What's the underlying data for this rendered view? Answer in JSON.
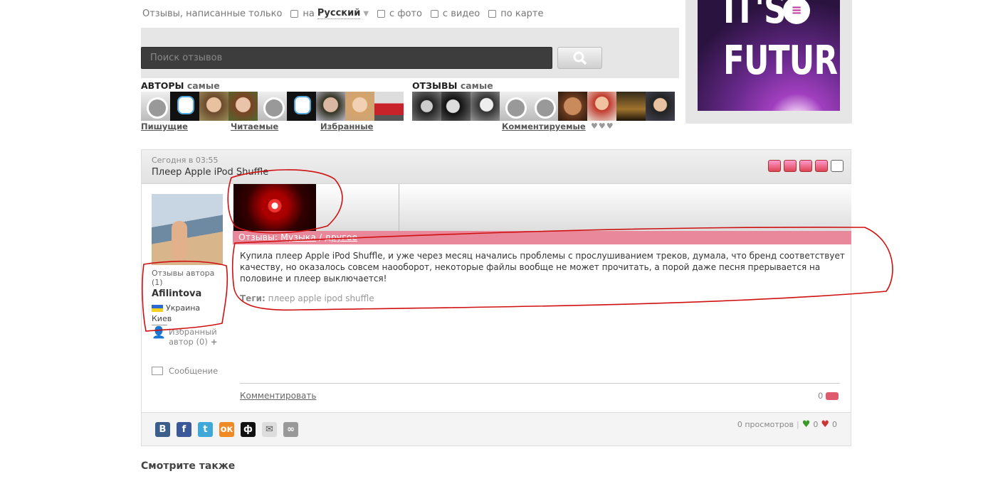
{
  "filters": {
    "intro": "Отзывы, написанные только",
    "lang_prefix": "на",
    "lang_value": "Русский",
    "with_photo": "с фото",
    "with_video": "с видео",
    "on_map": "по карте"
  },
  "search": {
    "placeholder": "Поиск отзывов"
  },
  "tops": {
    "authors_title": "АВТОРЫ",
    "authors_suffix": "самые",
    "reviews_title": "ОТЗЫВЫ",
    "reviews_suffix": "самые",
    "links": [
      "Пишущие",
      "Читаемые",
      "Избранные",
      "Комментируемые"
    ]
  },
  "ad": {
    "line1": "IT'S",
    "line2": "FUTURE",
    "logo": "≡"
  },
  "review": {
    "date": "Сегодня в 03:55",
    "title": "Плеер Apple iPod Shuffle",
    "category_label": "Отзывы:",
    "category": "Музыка",
    "subcategory": "другое",
    "text": "Купила плеер Apple iPod Shuffle, и уже через месяц начались проблемы с прослушиванием треков, думала, что бренд соответствует качеству, но оказалось совсем наооборот, некоторые файлы вообще не может прочитать, а порой даже песня прерывается на половине и плеер выключается!",
    "tags_label": "Теги:",
    "tags": "плеер apple ipod shuffle",
    "comment_link": "Комментировать",
    "comments_count": "0",
    "views": "0 просмотров",
    "likes": "0",
    "dislikes": "0"
  },
  "author": {
    "reviews_label": "Отзывы автора (1)",
    "name": "Afilintova",
    "country": "Украина",
    "city": "Киев",
    "fav_label_1": "Избранный",
    "fav_label_2": "автор (0)",
    "message_label": "Сообщение"
  },
  "share_icons": [
    "В",
    "f",
    "t",
    "ок",
    "ф",
    "✉",
    "∞"
  ],
  "see_also": "Смотрите также"
}
